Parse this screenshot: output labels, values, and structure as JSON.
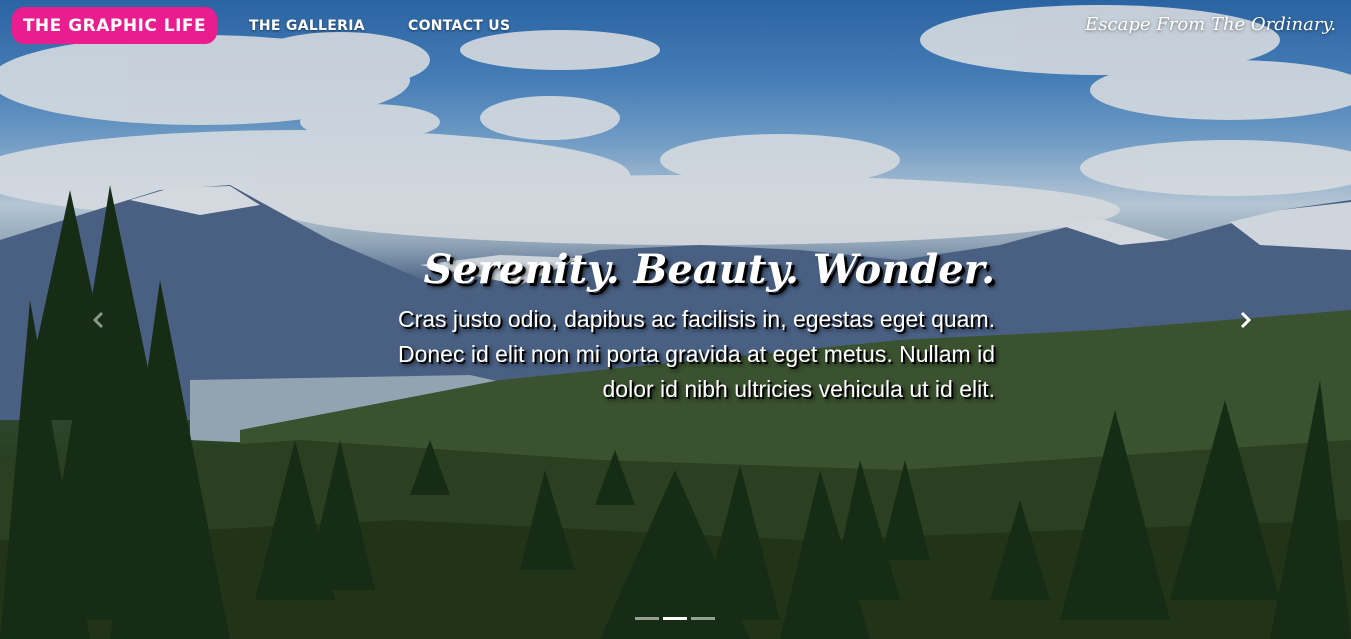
{
  "nav": {
    "brand": "THE GRAPHIC LIFE",
    "links": [
      {
        "label": "THE GALLERIA"
      },
      {
        "label": "CONTACT US"
      }
    ],
    "tagline": "Escape From The Ordinary."
  },
  "carousel": {
    "caption_title": "Serenity. Beauty. Wonder.",
    "caption_text": "Cras justo odio, dapibus ac facilisis in, egestas eget quam. Donec id elit non mi porta gravida at eget metus. Nullam id dolor id nibh ultricies vehicula ut id elit.",
    "prev_icon": "chevron-left-icon",
    "next_icon": "chevron-right-icon",
    "indicators": 3,
    "active_indicator": 2
  },
  "colors": {
    "brand": "#ea1d8e"
  }
}
